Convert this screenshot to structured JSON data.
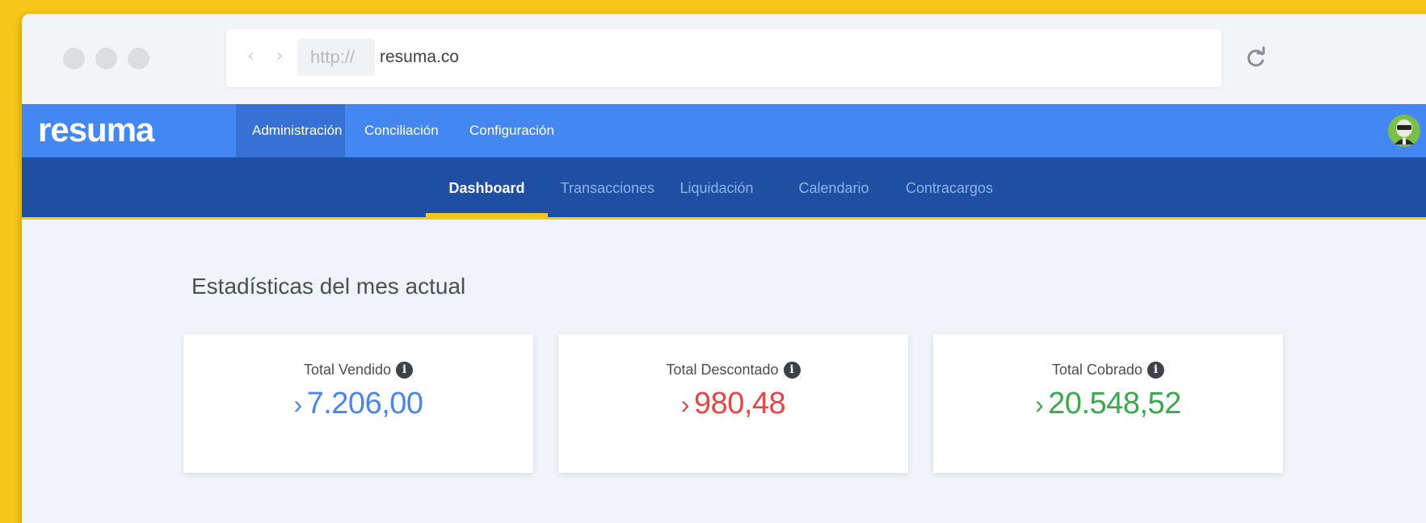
{
  "browser": {
    "protocol": "http://",
    "url": "resuma.co",
    "back_forward": "‹ ›"
  },
  "app": {
    "logo": "resuma"
  },
  "top_nav": [
    {
      "label": "Administración",
      "active": true
    },
    {
      "label": "Conciliación",
      "active": false
    },
    {
      "label": "Configuración",
      "active": false
    }
  ],
  "sub_nav": [
    {
      "label": "Dashboard",
      "active": true
    },
    {
      "label": "Transacciones",
      "active": false
    },
    {
      "label": "Liquidación",
      "active": false
    },
    {
      "label": "Calendario",
      "active": false
    },
    {
      "label": "Contracargos",
      "active": false
    }
  ],
  "section_title": "Estadísticas del mes actual",
  "cards": [
    {
      "label": "Total Vendido",
      "chevron": "›",
      "value": "7.206,00",
      "color": "#4a86e8"
    },
    {
      "label": "Total Descontado",
      "chevron": "›",
      "value": "980,48",
      "color": "#e84545"
    },
    {
      "label": "Total Cobrado",
      "chevron": "›",
      "value": "20.548,52",
      "color": "#3aa84d"
    }
  ],
  "colors": {
    "top_nav": "#4387f3",
    "sub_nav": "#1e4fa3",
    "accent": "#f7c61a"
  },
  "icons": {
    "info": "info-icon",
    "reload": "reload-icon",
    "avatar": "user-avatar"
  }
}
